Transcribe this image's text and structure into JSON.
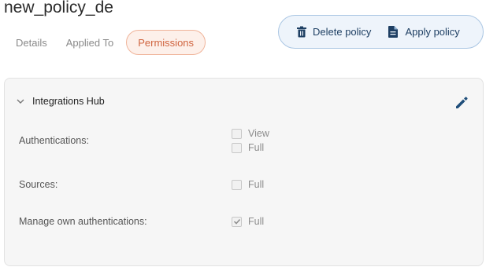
{
  "page": {
    "title": "new_policy_de"
  },
  "tabs": [
    {
      "label": "Details",
      "active": false
    },
    {
      "label": "Applied To",
      "active": false
    },
    {
      "label": "Permissions",
      "active": true
    }
  ],
  "actions": {
    "delete_label": "Delete policy",
    "apply_label": "Apply policy",
    "delete_icon": "trash-icon",
    "apply_icon": "document-icon"
  },
  "section": {
    "title": "Integrations Hub",
    "expanded": true,
    "rows": [
      {
        "label": "Authentications:",
        "options": [
          {
            "label": "View",
            "checked": false
          },
          {
            "label": "Full",
            "checked": false
          }
        ]
      },
      {
        "label": "Sources:",
        "options": [
          {
            "label": "Full",
            "checked": false
          }
        ]
      },
      {
        "label": "Manage own authentications:",
        "options": [
          {
            "label": "Full",
            "checked": true
          }
        ]
      }
    ]
  },
  "colors": {
    "accent_tab": "#d0643f",
    "action_text": "#1e3f63",
    "edit_icon": "#1f4e7a"
  }
}
